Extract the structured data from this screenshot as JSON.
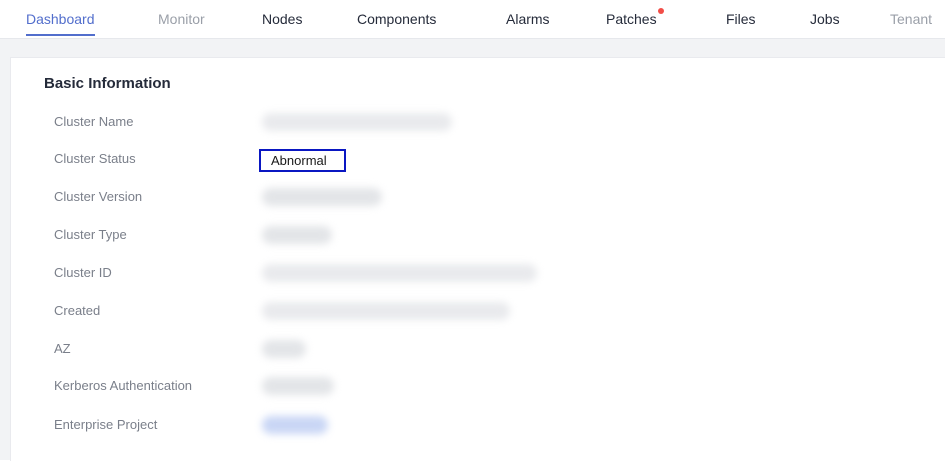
{
  "tabs": [
    {
      "label": "Dashboard",
      "state": "active"
    },
    {
      "label": "Monitor",
      "state": "muted"
    },
    {
      "label": "Nodes",
      "state": "normal"
    },
    {
      "label": "Components",
      "state": "normal"
    },
    {
      "label": "Alarms",
      "state": "normal"
    },
    {
      "label": "Patches",
      "state": "normal",
      "badge_color": "#f24d47"
    },
    {
      "label": "Files",
      "state": "normal"
    },
    {
      "label": "Jobs",
      "state": "normal"
    },
    {
      "label": "Tenant",
      "state": "muted"
    }
  ],
  "basic_info": {
    "title": "Basic Information",
    "rows": [
      {
        "label": "Cluster Name"
      },
      {
        "label": "Cluster Status",
        "value": "Abnormal"
      },
      {
        "label": "Cluster Version"
      },
      {
        "label": "Cluster Type"
      },
      {
        "label": "Cluster ID"
      },
      {
        "label": "Created"
      },
      {
        "label": "AZ"
      },
      {
        "label": "Kerberos Authentication"
      },
      {
        "label": "Enterprise Project"
      }
    ]
  },
  "colors": {
    "accent": "#526ecc",
    "highlight_border": "#0a17c2",
    "badge": "#f24d47"
  }
}
